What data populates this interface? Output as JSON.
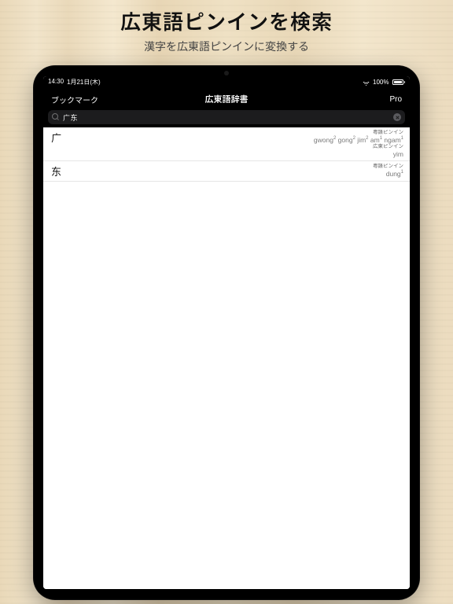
{
  "promo": {
    "title": "広東語ピンインを検索",
    "subtitle": "漢字を広東語ピンインに変換する"
  },
  "status": {
    "time": "14:30",
    "date": "1月21日(木)",
    "battery_pct": "100%"
  },
  "nav": {
    "left": "ブックマーク",
    "title": "広東語辞書",
    "right": "Pro"
  },
  "search": {
    "value": "广东"
  },
  "labels": {
    "jyutping": "粤語ピンイン",
    "cantonese_pinyin": "広東ピンイン"
  },
  "results": [
    {
      "char": "广",
      "lines": [
        {
          "label_key": "jyutping",
          "reading_html": "gwong<sup>2</sup> gong<sup>2</sup> jim<sup>2</sup> am<sup>1</sup> ngam<sup>1</sup>"
        },
        {
          "label_key": "cantonese_pinyin",
          "reading_html": "yim"
        }
      ]
    },
    {
      "char": "东",
      "lines": [
        {
          "label_key": "jyutping",
          "reading_html": "dung<sup>1</sup>"
        }
      ]
    }
  ]
}
